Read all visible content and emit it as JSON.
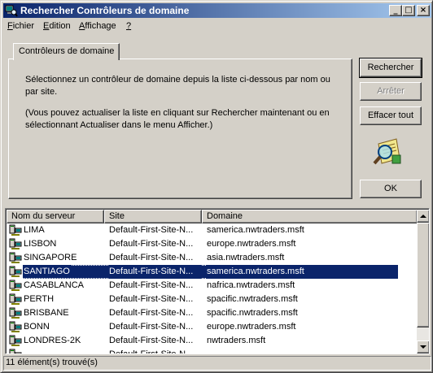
{
  "window": {
    "title": "Rechercher Contrôleurs de domaine",
    "controls": {
      "minimize": "_",
      "maximize": "□",
      "close": "×"
    }
  },
  "menu": [
    {
      "label_ul": "F",
      "label_rest": "ichier"
    },
    {
      "label_ul": "E",
      "label_rest": "dition"
    },
    {
      "label_ul": "A",
      "label_rest": "ffichage"
    },
    {
      "label_ul": "?",
      "label_rest": ""
    }
  ],
  "tab": {
    "label": "Contrôleurs de domaine"
  },
  "panel": {
    "instruction": "Sélectionnez un contrôleur de domaine depuis la liste ci-dessous par nom ou par site.",
    "note": "(Vous pouvez actualiser la liste en cliquant sur Rechercher maintenant ou en sélectionnant Actualiser dans le menu Afficher.)"
  },
  "buttons": {
    "search": "Rechercher",
    "stop": "Arrêter",
    "clear": "Effacer tout",
    "ok": "OK"
  },
  "icons": {
    "title": "find-computer-icon",
    "search_art": "magnifier-search-icon",
    "server": "domain-controller-icon"
  },
  "colors": {
    "selection": "#0a246a",
    "title_gradient_start": "#0a246a",
    "title_gradient_end": "#a6caf0"
  },
  "list": {
    "columns": [
      "Nom du serveur",
      "Site",
      "Domaine"
    ],
    "rows": [
      {
        "name": "LIMA",
        "site": "Default-First-Site-N...",
        "domain": "samerica.nwtraders.msft"
      },
      {
        "name": "LISBON",
        "site": "Default-First-Site-N...",
        "domain": "europe.nwtraders.msft"
      },
      {
        "name": "SINGAPORE",
        "site": "Default-First-Site-N...",
        "domain": "asia.nwtraders.msft"
      },
      {
        "name": "SANTIAGO",
        "site": "Default-First-Site-N...",
        "domain": "samerica.nwtraders.msft",
        "selected": true
      },
      {
        "name": "CASABLANCA",
        "site": "Default-First-Site-N...",
        "domain": "nafrica.nwtraders.msft"
      },
      {
        "name": "PERTH",
        "site": "Default-First-Site-N...",
        "domain": "spacific.nwtraders.msft"
      },
      {
        "name": "BRISBANE",
        "site": "Default-First-Site-N...",
        "domain": "spacific.nwtraders.msft"
      },
      {
        "name": "BONN",
        "site": "Default-First-Site-N...",
        "domain": "europe.nwtraders.msft"
      },
      {
        "name": "LONDRES-2K",
        "site": "Default-First-Site-N...",
        "domain": "nwtraders.msft"
      },
      {
        "name": "",
        "site": "Default-First-Site-N...",
        "domain": ""
      }
    ]
  },
  "status": {
    "text": "11 élément(s) trouvé(s)"
  }
}
